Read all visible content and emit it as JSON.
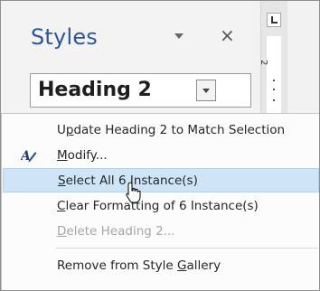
{
  "pane": {
    "title": "Styles",
    "close_glyph": "×",
    "current_style": "Heading 2"
  },
  "ruler": {
    "number": "2"
  },
  "menu": {
    "items": [
      {
        "pre": "U",
        "ul": "p",
        "post": "date Heading 2 to Match Selection",
        "enabled": true,
        "icon": null
      },
      {
        "pre": "",
        "ul": "M",
        "post": "odify...",
        "enabled": true,
        "icon": "modify-style-icon"
      },
      {
        "pre": "",
        "ul": "S",
        "post": "elect All 6 Instance(s)",
        "enabled": true,
        "highlighted": true,
        "icon": null
      },
      {
        "pre": "",
        "ul": "C",
        "post": "lear Formatting of 6 Instance(s)",
        "enabled": true,
        "icon": null
      },
      {
        "pre": "",
        "ul": "D",
        "post": "elete Heading 2...",
        "enabled": false,
        "icon": null
      },
      {
        "pre": "Remove from Style ",
        "ul": "G",
        "post": "allery",
        "enabled": true,
        "icon": null
      }
    ]
  },
  "colors": {
    "accent": "#2b579a",
    "highlight": "#cde5f7"
  }
}
